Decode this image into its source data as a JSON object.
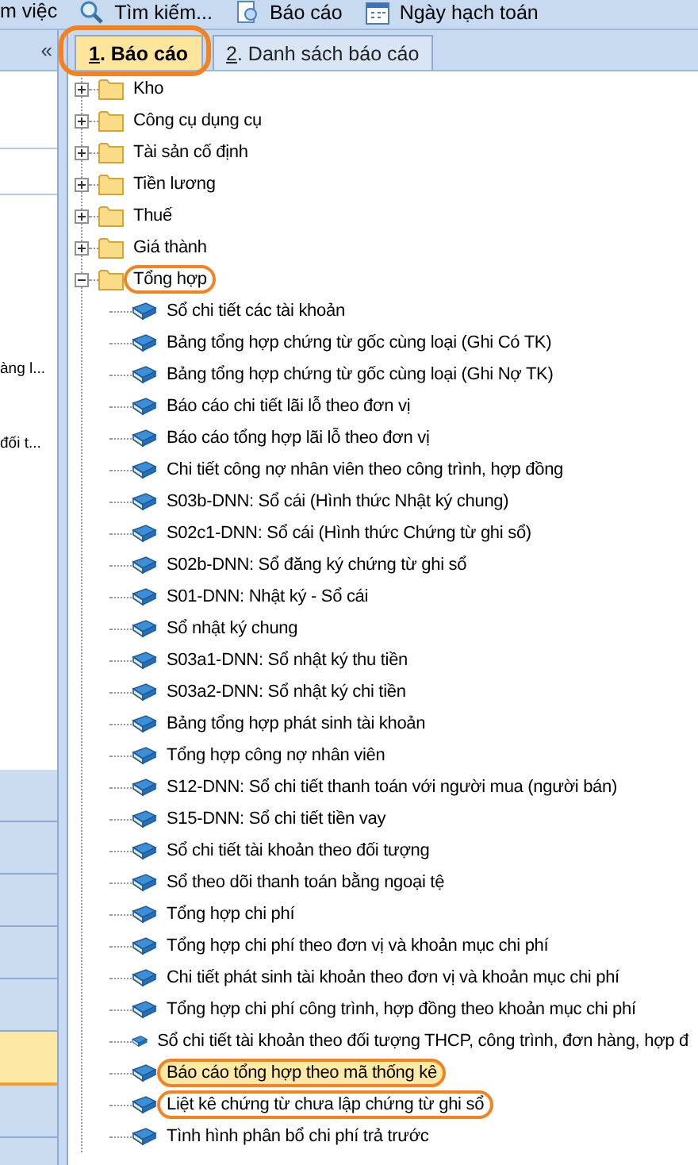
{
  "toolbar": [
    {
      "kind": "text",
      "label": "m việc"
    },
    {
      "kind": "search",
      "label": "Tìm kiếm..."
    },
    {
      "kind": "report",
      "label": "Báo cáo"
    },
    {
      "kind": "calendar",
      "label": "Ngày hạch toán"
    }
  ],
  "side_panel": {
    "collapse_button": "«",
    "texts": [
      "àng l...",
      "đối t..."
    ],
    "rows": [
      {
        "selected": false
      },
      {
        "selected": false
      },
      {
        "selected": false
      },
      {
        "selected": false
      },
      {
        "selected": false
      },
      {
        "selected": true
      },
      {
        "selected": false
      },
      {
        "selected": false
      }
    ]
  },
  "tabs_marked": true,
  "tabs": [
    {
      "label": "1. Báo cáo",
      "selected": true
    },
    {
      "label": "2. Danh sách báo cáo",
      "selected": false
    }
  ],
  "tree": [
    {
      "label": "Kho",
      "expanded": false,
      "marked": false
    },
    {
      "label": "Công cụ dụng cụ",
      "expanded": false,
      "marked": false
    },
    {
      "label": "Tài sản cố định",
      "expanded": false,
      "marked": false
    },
    {
      "label": "Tiền lương",
      "expanded": false,
      "marked": false
    },
    {
      "label": "Thuế",
      "expanded": false,
      "marked": false
    },
    {
      "label": "Giá thành",
      "expanded": false,
      "marked": false
    },
    {
      "label": "Tổng hợp",
      "expanded": true,
      "marked": true,
      "children": [
        {
          "label": "Sổ chi tiết các tài khoản",
          "selected": false,
          "marked": false
        },
        {
          "label": "Bảng tổng hợp chứng từ gốc cùng loại (Ghi Có TK)",
          "selected": false,
          "marked": false
        },
        {
          "label": "Bảng tổng hợp chứng từ gốc cùng loại (Ghi Nợ TK)",
          "selected": false,
          "marked": false
        },
        {
          "label": "Báo cáo chi tiết lãi lỗ theo đơn vị",
          "selected": false,
          "marked": false
        },
        {
          "label": "Báo cáo tổng hợp lãi lỗ theo đơn vị",
          "selected": false,
          "marked": false
        },
        {
          "label": "Chi tiết công nợ nhân viên theo công trình, hợp đồng",
          "selected": false,
          "marked": false
        },
        {
          "label": "S03b-DNN: Sổ cái (Hình thức Nhật ký chung)",
          "selected": false,
          "marked": false
        },
        {
          "label": "S02c1-DNN: Sổ cái (Hình thức Chứng từ ghi sổ)",
          "selected": false,
          "marked": false
        },
        {
          "label": "S02b-DNN: Sổ đăng ký chứng từ ghi sổ",
          "selected": false,
          "marked": false
        },
        {
          "label": "S01-DNN: Nhật ký - Sổ cái",
          "selected": false,
          "marked": false
        },
        {
          "label": "Sổ nhật ký chung",
          "selected": false,
          "marked": false
        },
        {
          "label": "S03a1-DNN: Sổ nhật ký thu tiền",
          "selected": false,
          "marked": false
        },
        {
          "label": "S03a2-DNN: Sổ nhật ký chi tiền",
          "selected": false,
          "marked": false
        },
        {
          "label": "Bảng tổng hợp phát sinh tài khoản",
          "selected": false,
          "marked": false
        },
        {
          "label": "Tổng hợp công nợ nhân viên",
          "selected": false,
          "marked": false
        },
        {
          "label": "S12-DNN: Sổ chi tiết thanh toán với người mua (người bán)",
          "selected": false,
          "marked": false
        },
        {
          "label": "S15-DNN: Sổ chi tiết tiền vay",
          "selected": false,
          "marked": false
        },
        {
          "label": "Sổ chi tiết tài khoản theo đối tượng",
          "selected": false,
          "marked": false
        },
        {
          "label": "Sổ theo dõi thanh toán bằng ngoại tệ",
          "selected": false,
          "marked": false
        },
        {
          "label": "Tổng hợp chi phí",
          "selected": false,
          "marked": false
        },
        {
          "label": "Tổng hợp chi phí theo đơn vị và khoản mục chi phí",
          "selected": false,
          "marked": false
        },
        {
          "label": "Chi tiết phát sinh tài khoản theo đơn vị và khoản mục chi phí",
          "selected": false,
          "marked": false
        },
        {
          "label": "Tổng hợp chi phí công trình, hợp đồng theo khoản mục chi phí",
          "selected": false,
          "marked": false
        },
        {
          "label": "Sổ chi tiết tài khoản theo đối tượng THCP, công trình, đơn hàng, hợp đ",
          "selected": false,
          "marked": false
        },
        {
          "label": "Báo cáo tổng hợp theo mã thống kê",
          "selected": true,
          "marked": true
        },
        {
          "label": "Liệt kê chứng từ chưa lập chứng từ ghi sổ",
          "selected": false,
          "marked": true
        },
        {
          "label": "Tình hình phân bổ chi phí trả trước",
          "selected": false,
          "marked": false
        }
      ]
    }
  ]
}
